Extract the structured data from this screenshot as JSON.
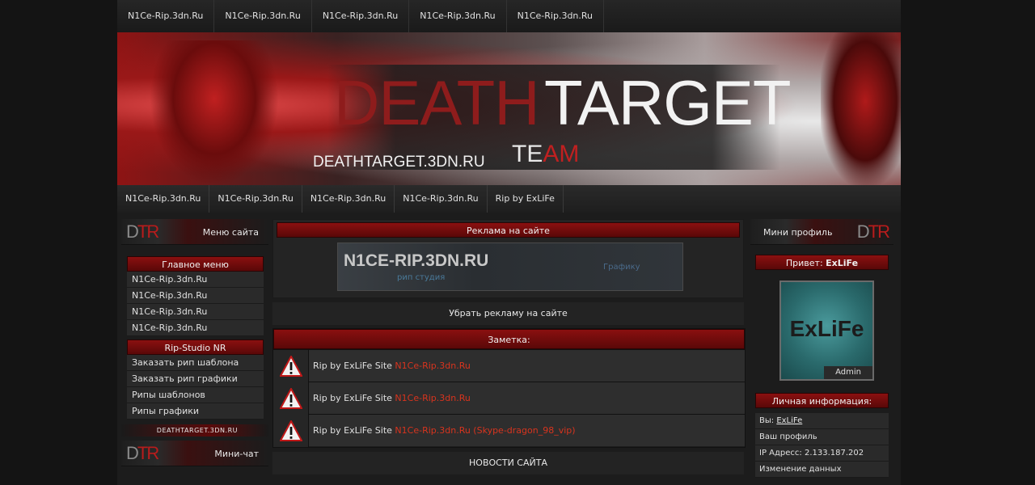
{
  "top_nav": [
    "N1Ce-Rip.3dn.Ru",
    "N1Ce-Rip.3dn.Ru",
    "N1Ce-Rip.3dn.Ru",
    "N1Ce-Rip.3dn.Ru",
    "N1Ce-Rip.3dn.Ru"
  ],
  "banner": {
    "word1": "DEATH",
    "word2": "TARGET",
    "url": "DEATHTARGET.3DN.RU",
    "team_prefix": "TE",
    "team_suffix": "AM"
  },
  "sub_nav": [
    "N1Ce-Rip.3dn.Ru",
    "N1Ce-Rip.3dn.Ru",
    "N1Ce-Rip.3dn.Ru",
    "N1Ce-Rip.3dn.Ru",
    "Rip by ExLiFe"
  ],
  "left": {
    "logo_a": "D",
    "logo_b": "TR",
    "menu_title": "Меню сайта",
    "main_menu_title": "Главное меню",
    "main_menu": [
      "N1Ce-Rip.3dn.Ru",
      "N1Ce-Rip.3dn.Ru",
      "N1Ce-Rip.3dn.Ru",
      "N1Ce-Rip.3dn.Ru"
    ],
    "studio_title": "Rip-Studio NR",
    "studio_menu": [
      "Заказать рип шаблона",
      "Заказать рип графики",
      "Рипы шаблонов",
      "Рипы графики"
    ],
    "strip_text": "DEATHTARGET.3DN.RU",
    "chat_title": "Мини-чат"
  },
  "center": {
    "ad_title": "Реклама на сайте",
    "ad_logo": "N1CE-RIP.3DN.RU",
    "ad_sub": "рип студия",
    "ad_right": "Графику",
    "remove_ad": "Убрать рекламу на сайте",
    "note_title": "Заметка:",
    "notes": [
      {
        "text": "Rip by ExLiFe Site ",
        "link": "N1Ce-Rip.3dn.Ru"
      },
      {
        "text": "Rip by ExLiFe Site ",
        "link": "N1Ce-Rip.3dn.Ru"
      },
      {
        "text": "Rip by ExLiFe Site ",
        "link": "N1Ce-Rip.3dn.Ru (Skype-dragon_98_vip)"
      }
    ],
    "news_title": "НОВОСТИ САЙТА"
  },
  "right": {
    "logo_a": "D",
    "logo_b": "TR",
    "profile_title": "Мини профиль",
    "greeting": "Привет: ",
    "username": "ExLiFe",
    "avatar_text": "ExLiFe",
    "avatar_role": "Admin",
    "info_title": "Личная информация:",
    "you_label": "Вы: ",
    "profile_link": "Ваш профиль",
    "ip": "IP Адресс: 2.133.187.202",
    "edit_data": "Изменение данных"
  },
  "colors": {
    "accent_red": "#8a1010",
    "link_red": "#d8341e",
    "avatar_teal": "#2a6a6c"
  }
}
